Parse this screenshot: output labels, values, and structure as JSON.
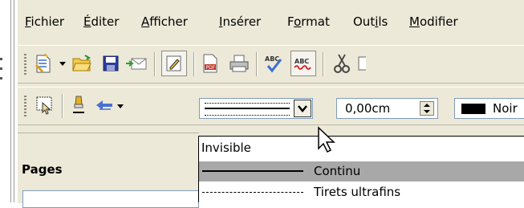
{
  "menubar": {
    "items": [
      {
        "label": "Fichier",
        "accel": "F",
        "rest": "ichier"
      },
      {
        "label": "Éditer",
        "accel": "É",
        "rest": "diter"
      },
      {
        "label": "Afficher",
        "accel": "A",
        "rest": "fficher"
      },
      {
        "label": "Insérer",
        "accel": "I",
        "rest": "nsérer"
      },
      {
        "label": "Format",
        "pre": "F",
        "accel": "o",
        "rest": "rmat"
      },
      {
        "label": "Outils",
        "pre": "Out",
        "accel": "i",
        "rest": "ls"
      },
      {
        "label": "Modifier",
        "accel": "M",
        "rest": "odifier"
      }
    ]
  },
  "toolbar_standard": {
    "icons": [
      "new-document-icon",
      "open-folder-icon",
      "save-icon",
      "email-icon",
      "edit-file-icon",
      "export-pdf-icon",
      "print-icon",
      "spellcheck-icon",
      "autospellcheck-icon",
      "cut-icon"
    ]
  },
  "toolbar_line": {
    "line_style_value": "Continu",
    "line_width_value": "0,00cm",
    "line_color_value": "Noir",
    "line_color_hex": "#000000"
  },
  "line_style_dropdown": {
    "options": [
      {
        "label": "Invisible",
        "selected": false
      },
      {
        "label": "Continu",
        "selected": true
      },
      {
        "label": "Tirets ultrafins",
        "selected": false
      }
    ]
  },
  "pages_panel": {
    "title": "Pages"
  },
  "colors": {
    "chrome": "#ece9d8",
    "selection": "#a8a8a8",
    "field_border": "#7f9db9"
  }
}
